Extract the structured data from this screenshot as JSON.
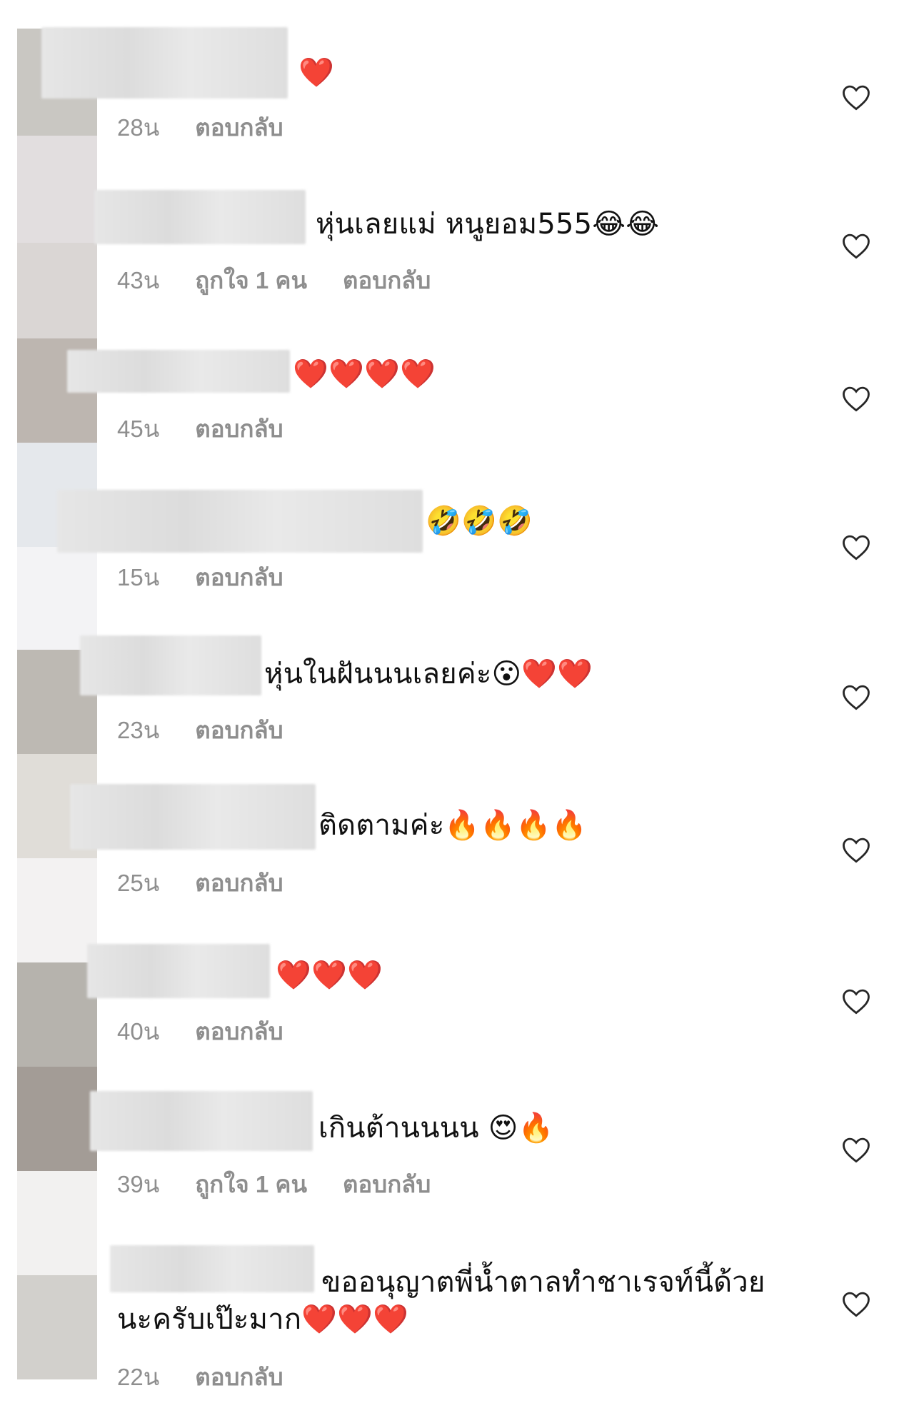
{
  "avatar_colors": [
    "#c9c7c2",
    "#e2dedf",
    "#dad6d4",
    "#bdb6b0",
    "#e5e8ec",
    "#f3f3f5",
    "#bdb9b3",
    "#e0ddd8",
    "#f3f2f2",
    "#b6b3ad",
    "#a39c96",
    "#f2f1f0",
    "#d2d0cc"
  ],
  "icons": {
    "like": "heart-outline-icon"
  },
  "comments": [
    {
      "text": "❤️",
      "time": "28น",
      "likes": "",
      "reply": "ตอบกลับ"
    },
    {
      "text": "หุ่นเลยแม่ หนูยอม555😂😂",
      "time": "43น",
      "likes": "ถูกใจ 1 คน",
      "reply": "ตอบกลับ"
    },
    {
      "text": "❤️❤️❤️❤️",
      "time": "45น",
      "likes": "",
      "reply": "ตอบกลับ"
    },
    {
      "text": "🤣🤣🤣",
      "time": "15น",
      "likes": "",
      "reply": "ตอบกลับ"
    },
    {
      "text": "หุ่นในฝันนนเลยค่ะ😮❤️❤️",
      "time": "23น",
      "likes": "",
      "reply": "ตอบกลับ"
    },
    {
      "text": "ติดตามค่ะ🔥🔥🔥🔥",
      "time": "25น",
      "likes": "",
      "reply": "ตอบกลับ"
    },
    {
      "text": "❤️❤️❤️",
      "time": "40น",
      "likes": "",
      "reply": "ตอบกลับ"
    },
    {
      "text": "เกินต้านนนน 😍🔥",
      "time": "39น",
      "likes": "ถูกใจ 1 คน",
      "reply": "ตอบกลับ"
    },
    {
      "text": "ขออนุญาตพี่น้ำตาลทำชาเรจท์นี้ด้วยนะครับเป๊ะมาก❤️❤️❤️",
      "time": "22น",
      "likes": "",
      "reply": "ตอบกลับ"
    }
  ]
}
